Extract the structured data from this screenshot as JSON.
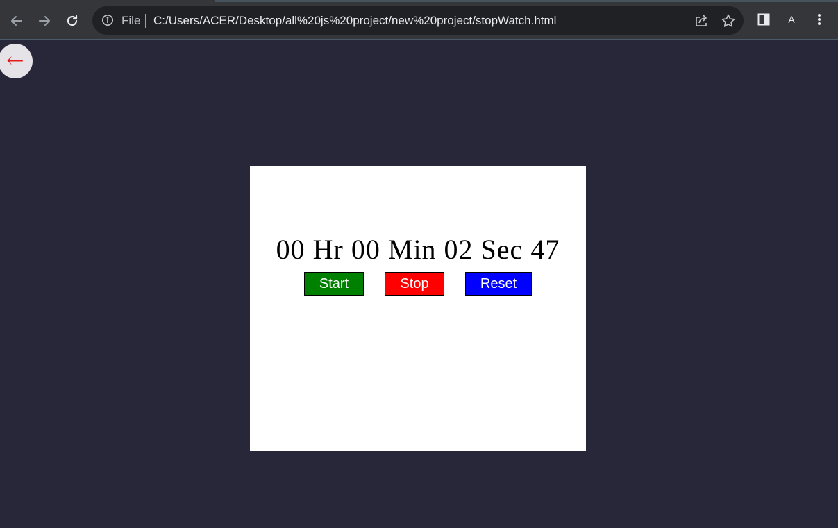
{
  "browser": {
    "scheme_label": "File",
    "url": "C:/Users/ACER/Desktop/all%20js%20project/new%20project/stopWatch.html",
    "profile_letter": "A",
    "icons": [
      "back-arrow-icon",
      "forward-arrow-icon",
      "reload-icon",
      "info-icon",
      "share-icon",
      "star-icon",
      "side-panel-icon",
      "profile-icon",
      "menu-icon"
    ]
  },
  "page": {
    "back_glyph": "←",
    "stopwatch": {
      "display": "00 Hr 00 Min 02 Sec 47",
      "buttons": {
        "start_label": "Start",
        "stop_label": "Stop",
        "reset_label": "Reset"
      }
    }
  },
  "colors": {
    "background": "#272739",
    "card": "#ffffff",
    "start": "#008000",
    "stop": "#ff0000",
    "reset": "#0000ff",
    "back_arrow": "#e41b1b"
  }
}
